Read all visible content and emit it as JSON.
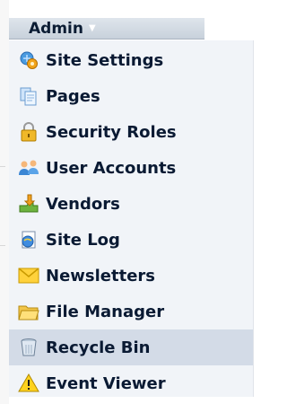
{
  "menu": {
    "title": "Admin",
    "items": [
      {
        "label": "Site Settings",
        "icon": "site-settings-icon",
        "selected": false
      },
      {
        "label": "Pages",
        "icon": "pages-icon",
        "selected": false
      },
      {
        "label": "Security Roles",
        "icon": "security-roles-icon",
        "selected": false
      },
      {
        "label": "User Accounts",
        "icon": "user-accounts-icon",
        "selected": false
      },
      {
        "label": "Vendors",
        "icon": "vendors-icon",
        "selected": false
      },
      {
        "label": "Site Log",
        "icon": "site-log-icon",
        "selected": false
      },
      {
        "label": "Newsletters",
        "icon": "newsletters-icon",
        "selected": false
      },
      {
        "label": "File Manager",
        "icon": "file-manager-icon",
        "selected": false
      },
      {
        "label": "Recycle Bin",
        "icon": "recycle-bin-icon",
        "selected": true
      },
      {
        "label": "Event Viewer",
        "icon": "event-viewer-icon",
        "selected": false
      }
    ]
  },
  "colors": {
    "header_bg": "#d2dae4",
    "menu_bg": "#f1f4f8",
    "selected_bg": "#d3dbe7",
    "text": "#0a1a33"
  }
}
